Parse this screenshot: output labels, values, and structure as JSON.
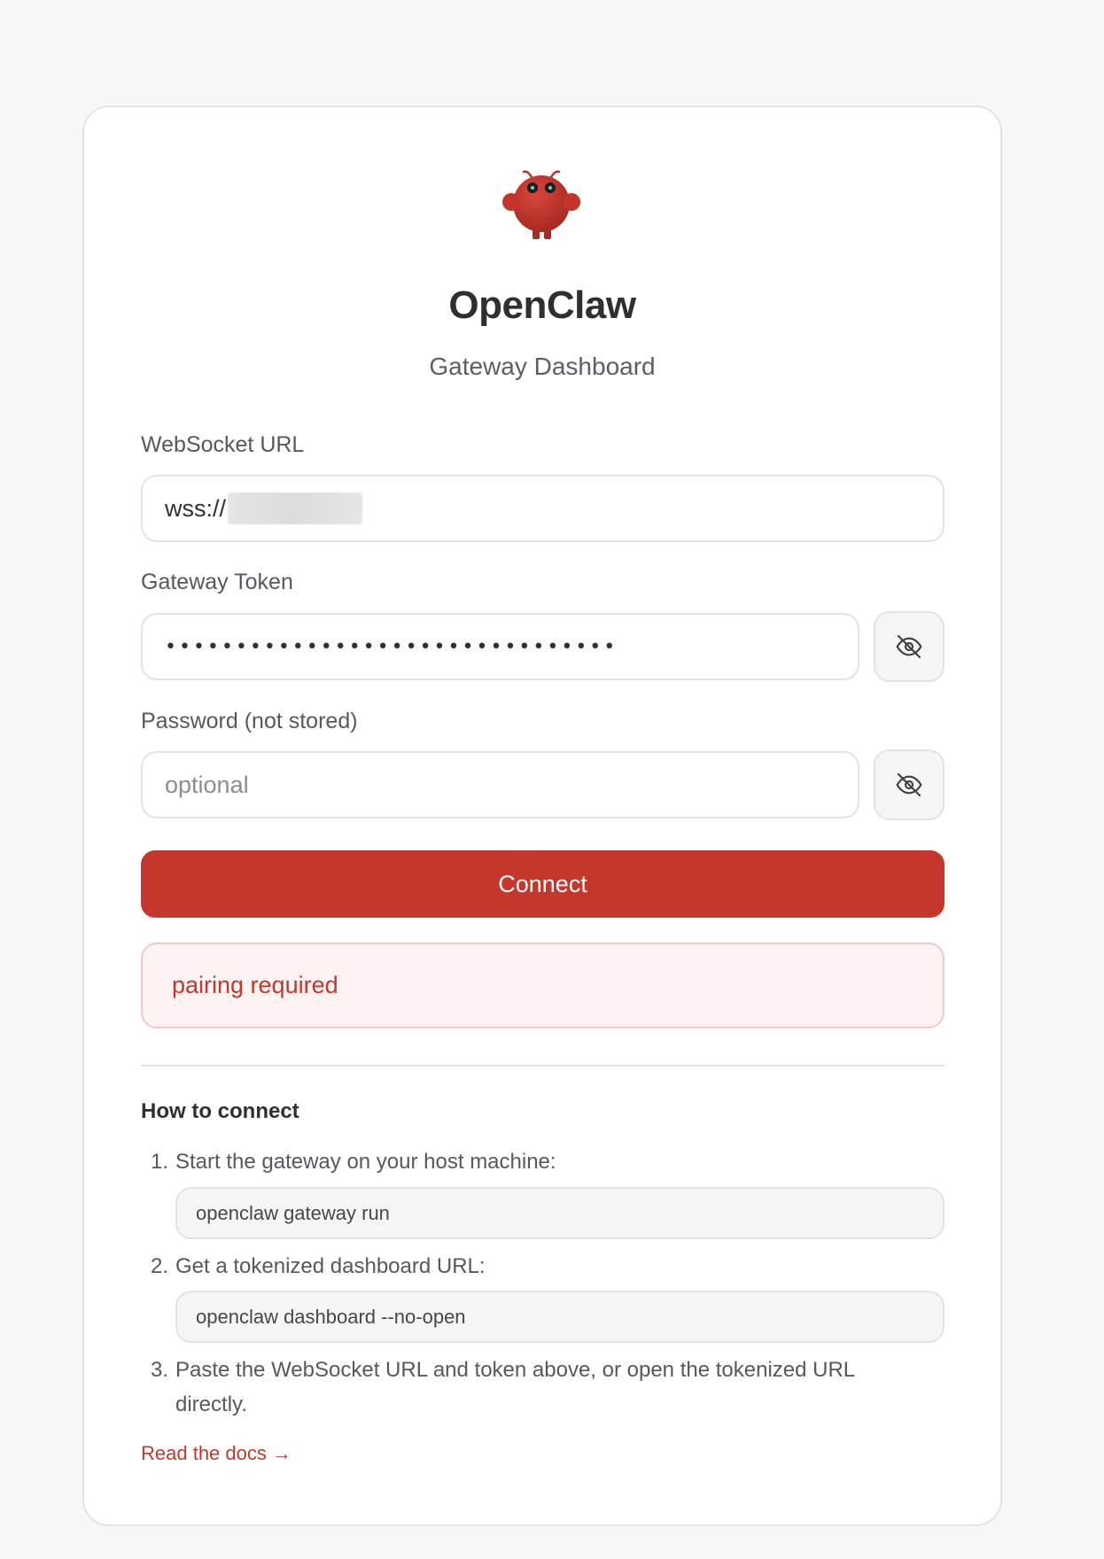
{
  "app": {
    "title": "OpenClaw",
    "subtitle": "Gateway Dashboard",
    "logo_icon": "claw-mascot-logo",
    "accent_color": "#c5362b"
  },
  "form": {
    "websocket": {
      "label": "WebSocket URL",
      "value_prefix": "wss://"
    },
    "token": {
      "label": "Gateway Token",
      "value_masked": "••••••••••••••••••••••••••••••••",
      "toggle_icon": "eye-off-icon"
    },
    "password": {
      "label": "Password (not stored)",
      "placeholder": "optional",
      "toggle_icon": "eye-off-icon"
    },
    "connect_label": "Connect"
  },
  "error": {
    "message": "pairing required"
  },
  "help": {
    "title": "How to connect",
    "steps": [
      {
        "num": "1.",
        "text": "Start the gateway on your host machine:",
        "code": "openclaw gateway run"
      },
      {
        "num": "2.",
        "text": "Get a tokenized dashboard URL:",
        "code": "openclaw dashboard --no-open"
      },
      {
        "num": "3.",
        "text": "Paste the WebSocket URL and token above, or open the tokenized URL",
        "text_cont": "directly."
      }
    ],
    "docs_link": "Read the docs →"
  }
}
